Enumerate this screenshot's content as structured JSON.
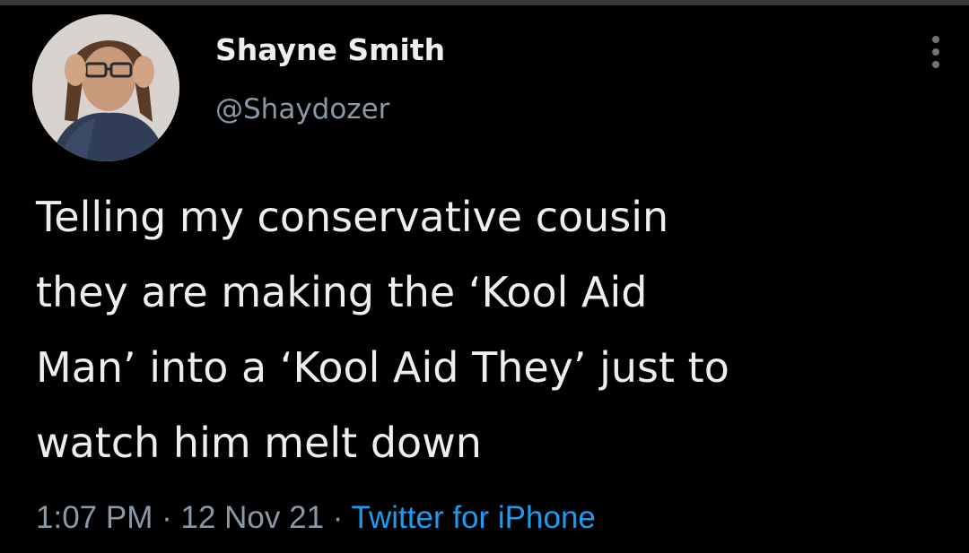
{
  "tweet": {
    "author": {
      "display_name": "Shayne Smith",
      "handle": "@Shaydozer",
      "avatar": "profile-photo"
    },
    "menu_icon": "more-vertical-icon",
    "text_lines": [
      "Telling my conservative cousin",
      "they are making the ‘Kool Aid",
      "Man’ into a ‘Kool Aid They’ just to",
      "watch him melt down"
    ],
    "meta": {
      "time": "1:07 PM",
      "separator": "·",
      "date": "12 Nov 21",
      "source": "Twitter for iPhone"
    }
  },
  "colors": {
    "background": "#000000",
    "text": "#eeeeee",
    "muted": "#8b98a5",
    "link": "#1d9bf0"
  }
}
